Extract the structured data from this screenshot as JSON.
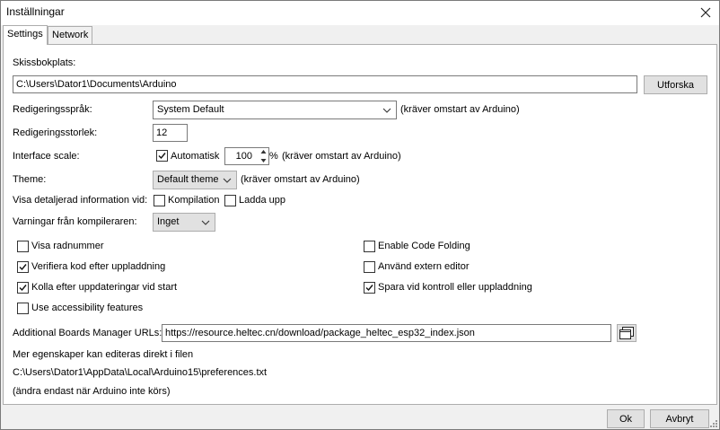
{
  "window": {
    "title": "Inställningar"
  },
  "tabs": [
    {
      "label": "Settings"
    },
    {
      "label": "Network"
    }
  ],
  "sketchbook": {
    "label": "Skissbokplats:",
    "value": "C:\\Users\\Dator1\\Documents\\Arduino",
    "browse_label": "Utforska"
  },
  "editor_language": {
    "label": "Redigeringsspråk:",
    "value": "System Default",
    "note": "(kräver omstart av Arduino)"
  },
  "editor_font_size": {
    "label": "Redigeringsstorlek:",
    "value": "12"
  },
  "interface_scale": {
    "label": "Interface scale:",
    "auto_label": "Automatisk",
    "auto_checked": true,
    "value": "100",
    "unit": "%",
    "note": "(kräver omstart av Arduino)"
  },
  "theme": {
    "label": "Theme:",
    "value": "Default theme",
    "note": "(kräver omstart av Arduino)"
  },
  "verbose": {
    "label": "Visa detaljerad information vid:",
    "compile_label": "Kompilation",
    "compile_checked": false,
    "upload_label": "Ladda upp",
    "upload_checked": false
  },
  "warnings": {
    "label": "Varningar från kompileraren:",
    "value": "Inget"
  },
  "options_left": [
    {
      "label": "Visa radnummer",
      "checked": false
    },
    {
      "label": "Verifiera kod efter uppladdning",
      "checked": true
    },
    {
      "label": "Kolla efter uppdateringar vid start",
      "checked": true
    },
    {
      "label": "Use accessibility features",
      "checked": false
    }
  ],
  "options_right": [
    {
      "label": "Enable Code Folding",
      "checked": false
    },
    {
      "label": "Använd extern editor",
      "checked": false
    },
    {
      "label": "Spara vid kontroll eller uppladdning",
      "checked": true
    }
  ],
  "boards_manager": {
    "label": "Additional Boards Manager URLs:",
    "value": "https://resource.heltec.cn/download/package_heltec_esp32_index.json"
  },
  "prefs_info": {
    "line1": "Mer egenskaper kan editeras direkt i filen",
    "path": "C:\\Users\\Dator1\\AppData\\Local\\Arduino15\\preferences.txt",
    "line3": "(ändra endast när Arduino inte körs)"
  },
  "footer": {
    "ok_label": "Ok",
    "cancel_label": "Avbryt"
  },
  "icons": {
    "close": "close-icon",
    "dropdown": "chevron-down-icon",
    "check": "checkmark-icon",
    "spin_up": "arrow-up-icon",
    "spin_down": "arrow-down-icon",
    "url_editor": "window-list-icon",
    "grip": "resize-grip-icon"
  }
}
